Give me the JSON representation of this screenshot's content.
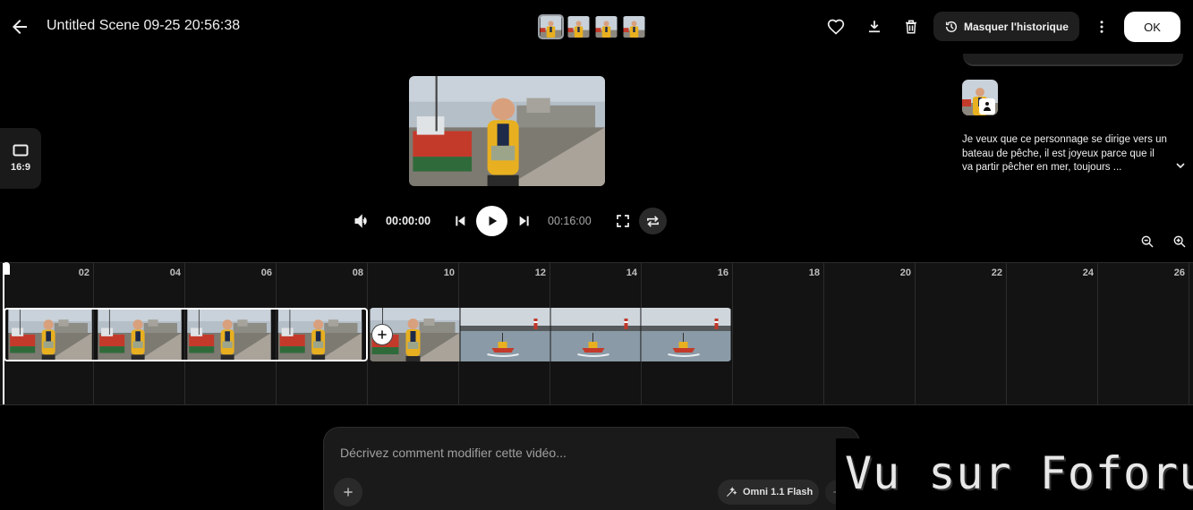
{
  "header": {
    "title": "Untitled Scene 09-25 20:56:38",
    "history_toggle_label": "Masquer l'historique",
    "ok_label": "OK"
  },
  "aspect": {
    "label": "16:9"
  },
  "playback": {
    "current_time": "00:00:00",
    "total_time": "00:16:00"
  },
  "history": {
    "prompt": "Je veux que ce personnage se dirige vers un bateau de pêche, il est joyeux parce que il va  partir pêcher en mer, toujours ..."
  },
  "timeline": {
    "ticks": [
      "02",
      "04",
      "06",
      "08",
      "10",
      "12",
      "14",
      "16",
      "18",
      "20",
      "22",
      "24",
      "26"
    ]
  },
  "chat": {
    "placeholder": "Décrivez comment modifier cette vidéo...",
    "model_label": "Omni 1.1 Flash"
  },
  "watermark": {
    "text": "Vu sur Foforum"
  },
  "colors": {
    "background": "#000000",
    "panel": "#1a1a1a",
    "timeline_bg": "#131313",
    "coat_yellow": "#e8b020",
    "accent_white": "#ffffff"
  },
  "icons": [
    "arrow-left-icon",
    "heart-icon",
    "download-icon",
    "trash-icon",
    "history-icon",
    "more-vert-icon",
    "aspect-ratio-icon",
    "volume-icon",
    "skip-previous-icon",
    "play-icon",
    "skip-next-icon",
    "fullscreen-icon",
    "repeat-icon",
    "zoom-out-icon",
    "zoom-in-icon",
    "chevron-down-icon",
    "plus-icon",
    "sparkle-icon",
    "arrow-right-icon"
  ]
}
